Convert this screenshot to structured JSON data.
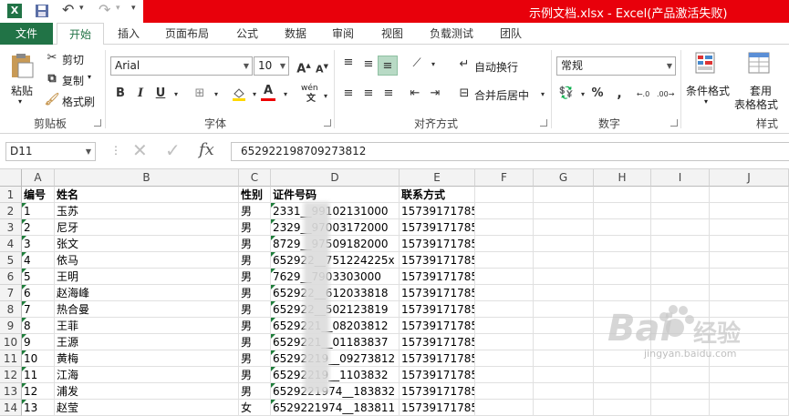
{
  "window": {
    "title": "示例文档.xlsx - Excel(产品激活失败)"
  },
  "tabs": [
    "文件",
    "开始",
    "插入",
    "页面布局",
    "公式",
    "数据",
    "审阅",
    "视图",
    "负载测试",
    "团队"
  ],
  "active_tab": "开始",
  "ribbon": {
    "paste_label": "粘贴",
    "cut_label": "剪切",
    "copy_label": "复制",
    "format_painter_label": "格式刷",
    "clipboard_group": "剪贴板",
    "font_name": "Arial",
    "font_size": "10",
    "font_group": "字体",
    "bold": "B",
    "italic": "I",
    "underline": "U",
    "wen_label": "wén",
    "wrap_text_label": "自动换行",
    "merge_center_label": "合并后居中",
    "alignment_group": "对齐方式",
    "number_format": "常规",
    "number_group": "数字",
    "conditional_format_label": "条件格式",
    "table_format_label_1": "套用",
    "table_format_label_2": "表格格式",
    "styles_group": "样式",
    "percent_label": "%"
  },
  "formula_bar": {
    "name_box": "D11",
    "fx": "fx",
    "formula": "652922198709273812"
  },
  "columns": [
    "A",
    "B",
    "C",
    "D",
    "E",
    "F",
    "G",
    "H",
    "I",
    "J"
  ],
  "rows": [
    {
      "n": "1",
      "a": "编号",
      "b": "姓名",
      "c": "性别",
      "d": "证件号码",
      "e": "联系方式"
    },
    {
      "n": "2",
      "a": "1",
      "b": "玉苏",
      "c": "男",
      "d": "2331__99102131000",
      "e": "15739171785"
    },
    {
      "n": "3",
      "a": "2",
      "b": "尼牙",
      "c": "男",
      "d": "2329__97003172000",
      "e": "15739171785"
    },
    {
      "n": "4",
      "a": "3",
      "b": "张文",
      "c": "男",
      "d": "8729__97509182000",
      "e": "15739171785"
    },
    {
      "n": "5",
      "a": "4",
      "b": "依马",
      "c": "男",
      "d": "652922__751224225x",
      "e": "15739171785"
    },
    {
      "n": "6",
      "a": "5",
      "b": "王明",
      "c": "男",
      "d": "7629__7903303000",
      "e": "15739171785"
    },
    {
      "n": "7",
      "a": "6",
      "b": "赵海峰",
      "c": "男",
      "d": "652922__612033818",
      "e": "15739171785"
    },
    {
      "n": "8",
      "a": "7",
      "b": "热合曼",
      "c": "男",
      "d": "652922__502123819",
      "e": "15739171785"
    },
    {
      "n": "9",
      "a": "8",
      "b": "王菲",
      "c": "男",
      "d": "6529221__08203812",
      "e": "15739171785"
    },
    {
      "n": "10",
      "a": "9",
      "b": "王源",
      "c": "男",
      "d": "6529221__01183837",
      "e": "15739171785"
    },
    {
      "n": "11",
      "a": "10",
      "b": "黄梅",
      "c": "男",
      "d": "65292219__09273812",
      "e": "15739171785"
    },
    {
      "n": "12",
      "a": "11",
      "b": "江海",
      "c": "男",
      "d": "65292219__1103832",
      "e": "15739171785"
    },
    {
      "n": "13",
      "a": "12",
      "b": "浦发",
      "c": "男",
      "d": "6529221974__183832",
      "e": "15739171785"
    },
    {
      "n": "14",
      "a": "13",
      "b": "赵莹",
      "c": "女",
      "d": "6529221974__183811",
      "e": "15739171785"
    }
  ],
  "watermark": {
    "brand": "Bai",
    "brand2": "经验",
    "url": "jingyan.baidu.com"
  },
  "colors": {
    "excel_green": "#217346",
    "title_red": "#e8000b",
    "marker_green": "#1e7d3a"
  }
}
